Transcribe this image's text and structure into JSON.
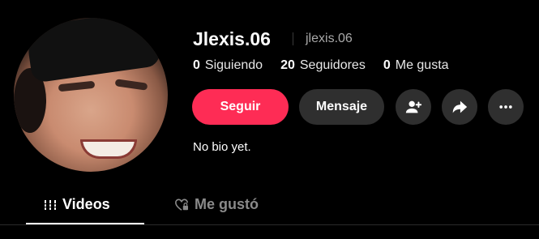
{
  "profile": {
    "display_name": "Jlexis.06",
    "handle": "jlexis.06",
    "bio": "No bio yet."
  },
  "stats": [
    {
      "count": "0",
      "label": "Siguiendo"
    },
    {
      "count": "20",
      "label": "Seguidores"
    },
    {
      "count": "0",
      "label": "Me gusta"
    }
  ],
  "actions": {
    "follow_label": "Seguir",
    "message_label": "Mensaje",
    "add_friend_icon": "add-user-icon",
    "share_icon": "share-icon",
    "more_icon": "more-icon"
  },
  "tabs": [
    {
      "label": "Videos",
      "icon": "grid-icon",
      "active": true
    },
    {
      "label": "Me gustó",
      "icon": "heart-lock-icon",
      "active": false
    }
  ],
  "colors": {
    "accent": "#fe2c55",
    "background": "#000000",
    "button_secondary": "#2f2f2f",
    "muted_text": "#a9a9a9"
  }
}
